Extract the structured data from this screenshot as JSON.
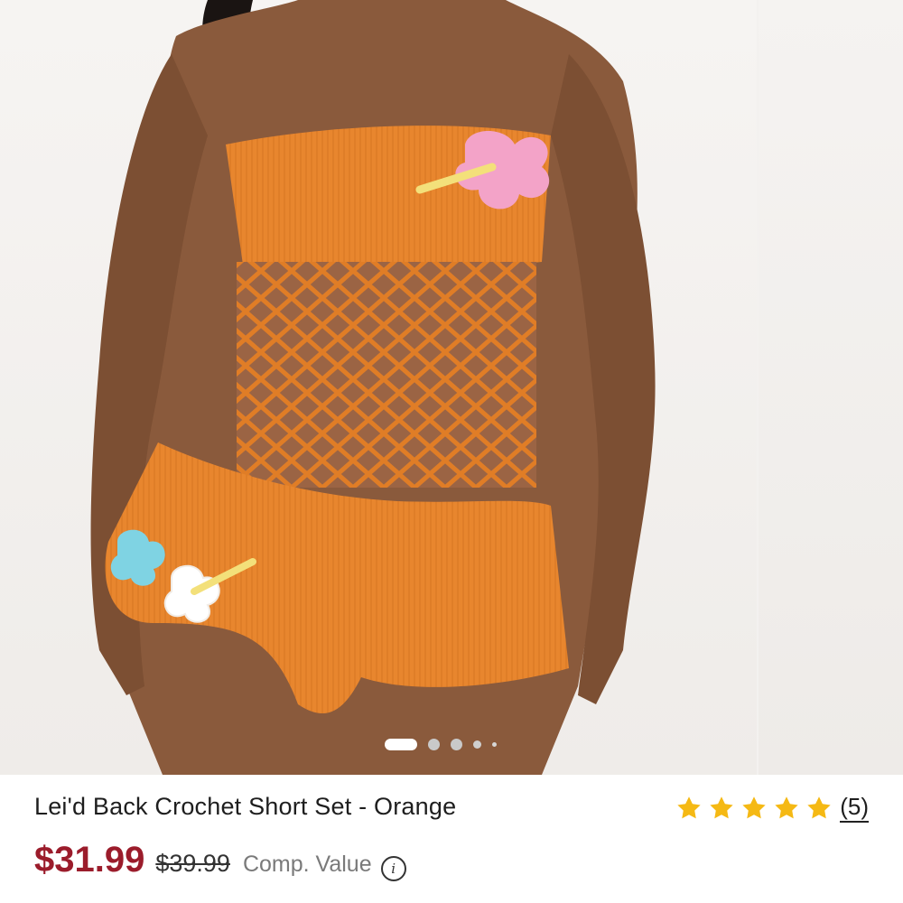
{
  "product": {
    "title": "Lei'd Back Crochet Short Set - Orange",
    "rating_stars": 5,
    "review_count": "(5)",
    "sale_price": "$31.99",
    "original_price": "$39.99",
    "comp_label": "Comp. Value",
    "info_icon": "i"
  },
  "gallery": {
    "image_count": 5,
    "active_index": 0
  },
  "colors": {
    "sale_price": "#9b1c2b",
    "star": "#f5b914",
    "garment": "#e8862e"
  },
  "icons": [
    "star-icon",
    "info-icon"
  ]
}
